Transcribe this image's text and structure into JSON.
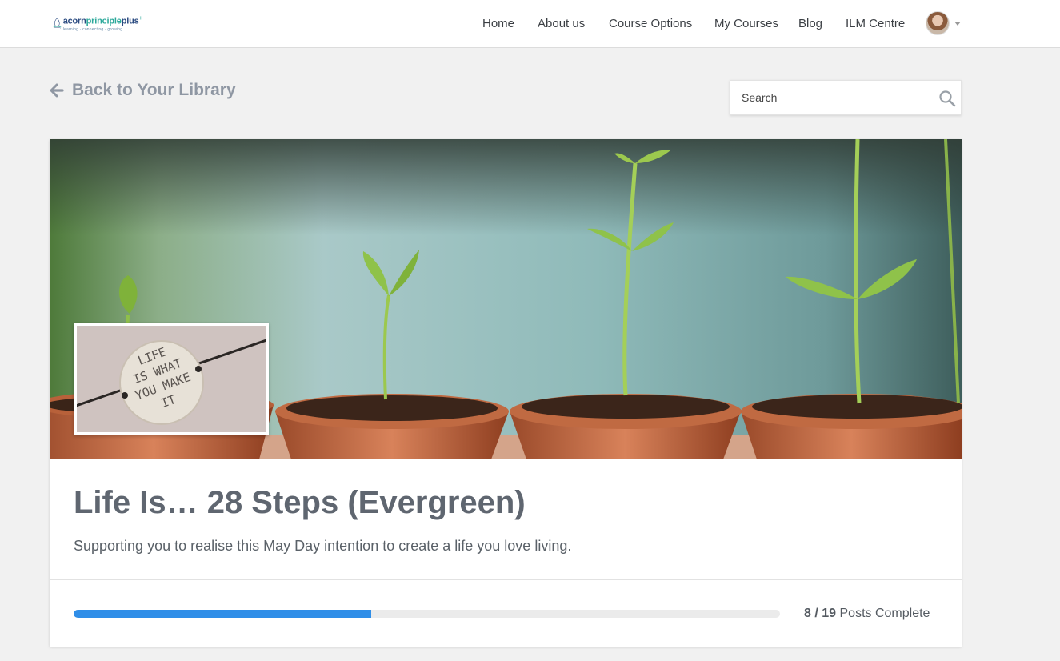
{
  "brand": {
    "name_part1": "acorn",
    "name_part2": "principle",
    "name_part3": "plus",
    "superscript": "+",
    "tagline": "learning · connecting · growing"
  },
  "nav": {
    "items": [
      "Home",
      "About us",
      "Course Options",
      "My Courses",
      "Blog",
      "ILM Centre"
    ]
  },
  "back_link": {
    "label": "Back to Your Library"
  },
  "search": {
    "placeholder": "Search"
  },
  "course": {
    "title": "Life Is… 28 Steps (Evergreen)",
    "description": "Supporting you to realise this May Day intention to create a life you love living.",
    "thumbnail_text": [
      "LIFE",
      "IS WHAT",
      "YOU MAKE",
      "IT"
    ],
    "progress": {
      "completed": "8",
      "separator": " / ",
      "total": "19",
      "suffix": " Posts Complete",
      "fraction": 0.421
    }
  },
  "colors": {
    "accent": "#2f8ee8",
    "text_muted": "#8f97a3",
    "title": "#5f6670"
  },
  "icons": [
    "logo-icon",
    "arrow-left-icon",
    "search-icon",
    "chevron-down-icon"
  ]
}
